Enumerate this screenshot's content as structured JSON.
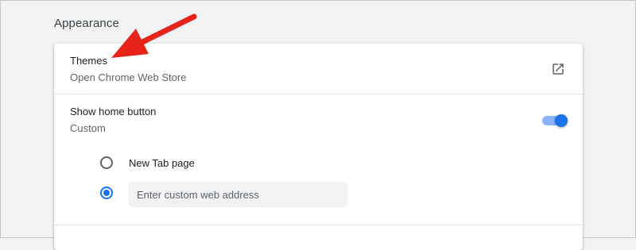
{
  "section": {
    "title": "Appearance"
  },
  "themes": {
    "title": "Themes",
    "subtitle": "Open Chrome Web Store",
    "action_icon": "open-in-new-icon"
  },
  "home_button": {
    "title": "Show home button",
    "subtitle": "Custom",
    "toggle_on": true,
    "options": [
      {
        "label": "New Tab page",
        "selected": false
      },
      {
        "label": "",
        "selected": true
      }
    ],
    "custom_address": {
      "value": "",
      "placeholder": "Enter custom web address"
    }
  },
  "annotation": {
    "icon": "red-arrow-icon",
    "color": "#e8231a"
  },
  "colors": {
    "accent": "#1a73e8",
    "toggle_track": "#8ab4f8",
    "background": "#f1f3f4",
    "card": "#ffffff"
  }
}
